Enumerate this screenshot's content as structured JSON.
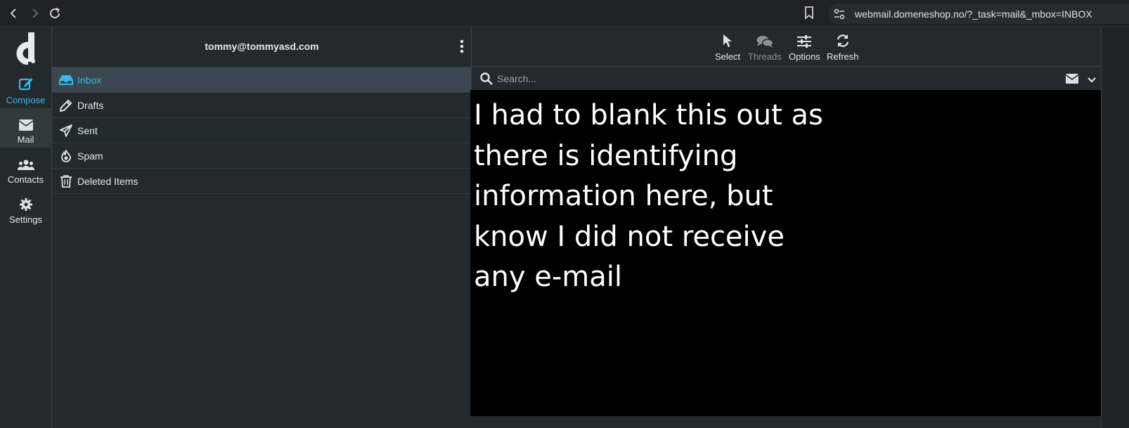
{
  "browser": {
    "url": "webmail.domeneshop.no/?_task=mail&_mbox=INBOX",
    "icons": [
      "back-icon",
      "forward-icon",
      "reload-icon",
      "bookmark-icon",
      "site-settings-icon"
    ]
  },
  "rail": {
    "logo": "d",
    "items": [
      {
        "label": "Compose",
        "icon": "compose-icon"
      },
      {
        "label": "Mail",
        "icon": "envelope-icon"
      },
      {
        "label": "Contacts",
        "icon": "contacts-icon"
      },
      {
        "label": "Settings",
        "icon": "gear-icon"
      }
    ]
  },
  "folders": {
    "account": "tommy@tommyasd.com",
    "items": [
      {
        "label": "Inbox",
        "icon": "inbox-icon",
        "active": true
      },
      {
        "label": "Drafts",
        "icon": "pencil-icon"
      },
      {
        "label": "Sent",
        "icon": "paper-plane-icon"
      },
      {
        "label": "Spam",
        "icon": "fire-icon"
      },
      {
        "label": "Deleted Items",
        "icon": "trash-icon"
      }
    ]
  },
  "toolbar": {
    "select": "Select",
    "threads": "Threads",
    "options": "Options",
    "refresh": "Refresh"
  },
  "search": {
    "placeholder": "Search..."
  },
  "overlay": {
    "text": "I had to blank this out as\nthere is identifying\ninformation here, but\nknow I did not receive\nany e-mail"
  },
  "colors": {
    "accent": "#37b6f0",
    "background": "#1f2427",
    "selected_row": "#3a474e",
    "overlay": "#000000"
  }
}
